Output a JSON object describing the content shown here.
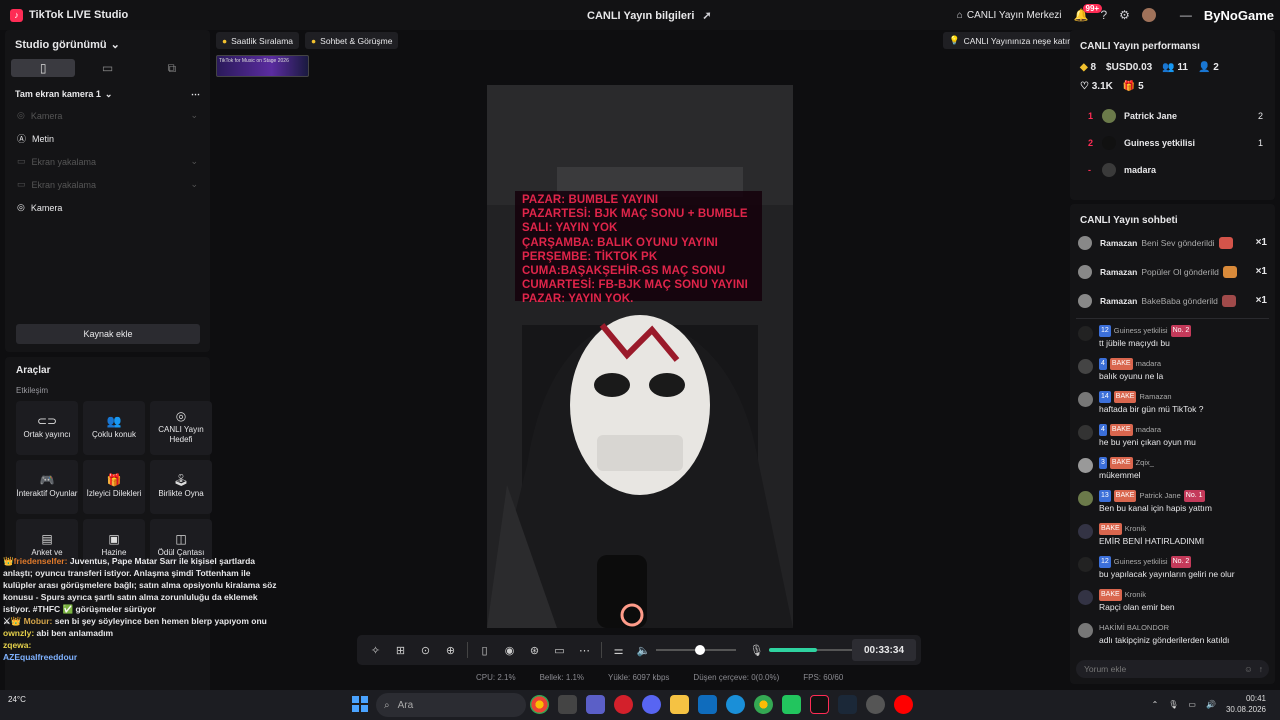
{
  "titlebar": {
    "app_name": "TikTok LIVE Studio",
    "center_title": "CANLI Yayın bilgileri",
    "live_center": "CANLI Yayın Merkezi",
    "notif_count": "99+",
    "watermark": "ByNoGame"
  },
  "left_panel": {
    "title": "Studio görünümü",
    "scene_name": "Tam ekran kamera 1",
    "sources": [
      {
        "label": "Kamera",
        "dim": true
      },
      {
        "label": "Metin",
        "dim": false
      },
      {
        "label": "Ekran yakalama",
        "dim": true
      },
      {
        "label": "Ekran yakalama",
        "dim": true
      },
      {
        "label": "Kamera",
        "dim": false
      }
    ],
    "add_source": "Kaynak ekle"
  },
  "tools": {
    "title": "Araçlar",
    "subtitle": "Etkileşim",
    "items": [
      {
        "label": "Ortak yayıncı",
        "icon": "link-icon"
      },
      {
        "label": "Çoklu konuk",
        "icon": "users-icon"
      },
      {
        "label": "CANLI Yayın Hedefi",
        "icon": "target-icon"
      },
      {
        "label": "İnteraktif Oyunlar",
        "icon": "gamepad-icon"
      },
      {
        "label": "İzleyici Dilekleri",
        "icon": "gift-icon"
      },
      {
        "label": "Birlikte Oyna",
        "icon": "joystick-icon"
      },
      {
        "label": "Anket ve",
        "icon": "poll-icon"
      },
      {
        "label": "Hazine",
        "icon": "chest-icon"
      },
      {
        "label": "Ödül Çantası",
        "icon": "bag-icon"
      }
    ]
  },
  "overlay_chat": [
    {
      "name": "friedenselfer:",
      "text": "Juventus, Pape Matar Sarr ile kişisel şartlarda anlaştı; oyuncu transferi istiyor. Anlaşma şimdi Tottenham ile kulüpler arası görüşmelere bağlı; satın alma opsiyonlu kiralama söz konusu - Spurs ayrıca şartlı satın alma zorunluluğu da eklemek istiyor. #THFC ✅ görüşmeler sürüyor"
    },
    {
      "name": "Mobur:",
      "text": "sen bi şey söyleyince ben hemen blerp yapıyom onu"
    },
    {
      "name": "ownzly:",
      "text": "abi ben anlamadım"
    },
    {
      "name": "zqewa:",
      "text": ""
    },
    {
      "name": "AZEqualfreeddour",
      "text": ""
    }
  ],
  "stream_chips": {
    "hourly": "Saatlik Sıralama",
    "chat": "Sohbet & Görüşme",
    "tip": "CANLI Yayınınıza neşe katın",
    "thumb": "TikTok for Music on Stage 2026"
  },
  "schedule": [
    "PAZAR: BUMBLE YAYINI",
    "PAZARTESİ: BJK MAÇ SONU + BUMBLE",
    "SALI: YAYIN YOK",
    "ÇARŞAMBA: BALIK OYUNU YAYINI",
    "PERŞEMBE: TİKTOK PK",
    "CUMA:BAŞAKŞEHİR-GS MAÇ SONU",
    "CUMARTESİ: FB-BJK MAÇ SONU YAYINI",
    "PAZAR: YAYIN YOK."
  ],
  "controls": {
    "timer": "00:33:34",
    "volume": 0.55,
    "mic": 0.5
  },
  "stats": [
    "CPU: 2.1%",
    "Bellek: 1.1%",
    "Yükle: 6097 kbps",
    "Düşen çerçeve: 0(0.0%)",
    "FPS: 60/60"
  ],
  "performance": {
    "title": "CANLI Yayın performansı",
    "diamonds": "8",
    "usd": "USD0.03",
    "viewers": "11",
    "new_followers": "2",
    "likes": "3.1K",
    "gifts": "5",
    "ranking": [
      {
        "rank": "1",
        "name": "Patrick Jane",
        "value": "2"
      },
      {
        "rank": "2",
        "name": "Guiness yetkilisi",
        "value": "1"
      },
      {
        "rank": "-",
        "name": "madara",
        "value": ""
      }
    ]
  },
  "live_chat": {
    "title": "CANLI Yayın sohbeti",
    "gifts": [
      {
        "user": "Ramazan",
        "text": "Beni Sev gönderildi",
        "count": "×1"
      },
      {
        "user": "Ramazan",
        "text": "Popüler Ol gönderild",
        "count": "×1"
      },
      {
        "user": "Ramazan",
        "text": "BakeBaba gönderild",
        "count": "×1"
      }
    ],
    "messages": [
      {
        "lvl": "12",
        "fan": "",
        "user": "Guiness yetkilisi",
        "rank": "No. 2",
        "text": "tt jübile maçıydı bu"
      },
      {
        "lvl": "4",
        "fan": "BAKE",
        "user": "madara",
        "rank": "",
        "text": "balık oyunu ne la"
      },
      {
        "lvl": "14",
        "fan": "BAKE",
        "user": "Ramazan",
        "rank": "",
        "text": "haftada bir gün mü TikTok ?"
      },
      {
        "lvl": "4",
        "fan": "BAKE",
        "user": "madara",
        "rank": "",
        "text": "he bu yeni çıkan oyun mu"
      },
      {
        "lvl": "3",
        "fan": "BAKE",
        "user": "Zqix_",
        "rank": "",
        "text": "mükemmel"
      },
      {
        "lvl": "13",
        "fan": "BAKE",
        "user": "Patrick Jane",
        "rank": "No. 1",
        "text": "Ben bu kanal için hapis yattım"
      },
      {
        "lvl": "",
        "fan": "BAKE",
        "user": "Kronik",
        "rank": "",
        "text": "EMİR BENİ HATIRLADINMI"
      },
      {
        "lvl": "12",
        "fan": "",
        "user": "Guiness yetkilisi",
        "rank": "No. 2",
        "text": "bu yapılacak yayınların geliri ne olur"
      },
      {
        "lvl": "",
        "fan": "BAKE",
        "user": "Kronik",
        "rank": "",
        "text": "Rapçi olan emir ben"
      },
      {
        "lvl": "",
        "fan": "",
        "user": "HAKİMİ BALONDOR",
        "rank": "",
        "text": "adlı takipçiniz gönderilerden katıldı"
      }
    ],
    "placeholder": "Yorum ekle"
  },
  "taskbar": {
    "search": "Ara",
    "weather": "24°C",
    "time": "00:41",
    "date": "30.08.2026"
  }
}
